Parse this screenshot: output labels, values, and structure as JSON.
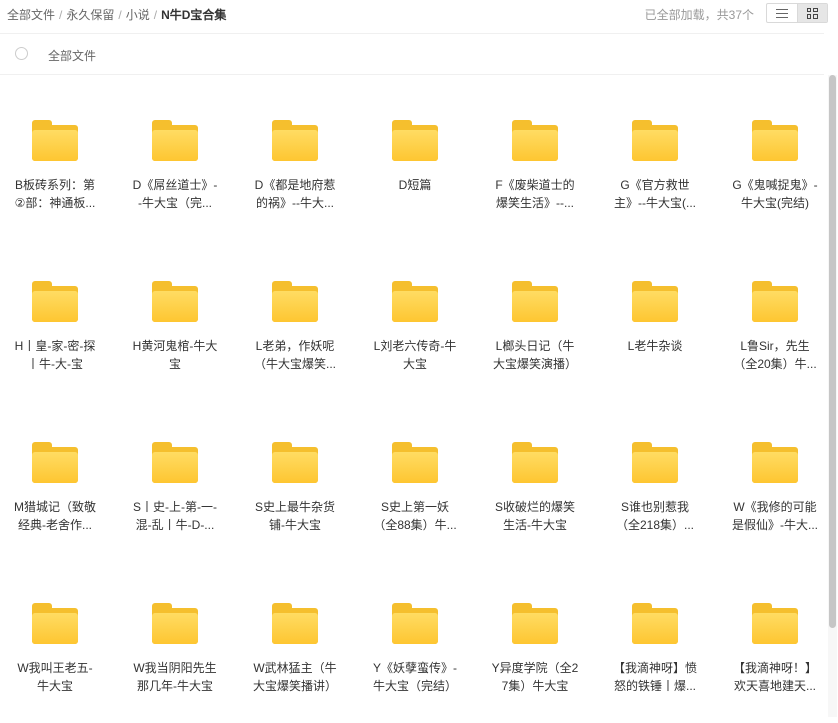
{
  "breadcrumb": [
    {
      "label": "全部文件"
    },
    {
      "label": "永久保留"
    },
    {
      "label": "小说"
    },
    {
      "label": "N牛D宝合集"
    }
  ],
  "breadcrumb_separator": "/",
  "status_text": "已全部加载，共37个",
  "view_toggle": {
    "active": "grid"
  },
  "header": {
    "select_all_label": "全部文件"
  },
  "files": [
    {
      "line1": "B板砖系列：第",
      "line2": "②部：神通板..."
    },
    {
      "line1": "D《屌丝道士》-",
      "line2": "-牛大宝（完..."
    },
    {
      "line1": "D《都是地府惹",
      "line2": "的祸》--牛大..."
    },
    {
      "line1": "D短篇",
      "line2": ""
    },
    {
      "line1": "F《废柴道士的",
      "line2": "爆笑生活》--..."
    },
    {
      "line1": "G《官方救世",
      "line2": "主》--牛大宝(..."
    },
    {
      "line1": "G《鬼喊捉鬼》-",
      "line2": "牛大宝(完结)"
    },
    {
      "line1": "H丨皇-家-密-探",
      "line2": "丨牛-大-宝"
    },
    {
      "line1": "H黄河鬼棺-牛大",
      "line2": "宝"
    },
    {
      "line1": "L老弟，作妖呢",
      "line2": "（牛大宝爆笑..."
    },
    {
      "line1": "L刘老六传奇-牛",
      "line2": "大宝"
    },
    {
      "line1": "L榔头日记（牛",
      "line2": "大宝爆笑演播）"
    },
    {
      "line1": "L老牛杂谈",
      "line2": ""
    },
    {
      "line1": "L鲁Sir，先生",
      "line2": "（全20集）牛..."
    },
    {
      "line1": "M猎城记（致敬",
      "line2": "经典-老舍作..."
    },
    {
      "line1": "S丨史-上-第-一-",
      "line2": "混-乱丨牛-D-..."
    },
    {
      "line1": "S史上最牛杂货",
      "line2": "铺-牛大宝"
    },
    {
      "line1": "S史上第一妖",
      "line2": "（全88集）牛..."
    },
    {
      "line1": "S收破烂的爆笑",
      "line2": "生活-牛大宝"
    },
    {
      "line1": "S谁也别惹我",
      "line2": "（全218集）..."
    },
    {
      "line1": "W《我修的可能",
      "line2": "是假仙》-牛大..."
    },
    {
      "line1": "W我叫王老五-",
      "line2": "牛大宝"
    },
    {
      "line1": "W我当阴阳先生",
      "line2": "那几年-牛大宝"
    },
    {
      "line1": "W武林猛主（牛",
      "line2": "大宝爆笑播讲）"
    },
    {
      "line1": "Y《妖孽蛮传》-",
      "line2": "牛大宝（完结）"
    },
    {
      "line1": "Y异度学院（全2",
      "line2": "7集）牛大宝"
    },
    {
      "line1": "【我滴神呀】愤",
      "line2": "怒的铁锤丨爆..."
    },
    {
      "line1": "【我滴神呀！】",
      "line2": "欢天喜地建天..."
    }
  ],
  "colors": {
    "folder_back": "#f5bf2e",
    "folder_front": "#fec631"
  }
}
